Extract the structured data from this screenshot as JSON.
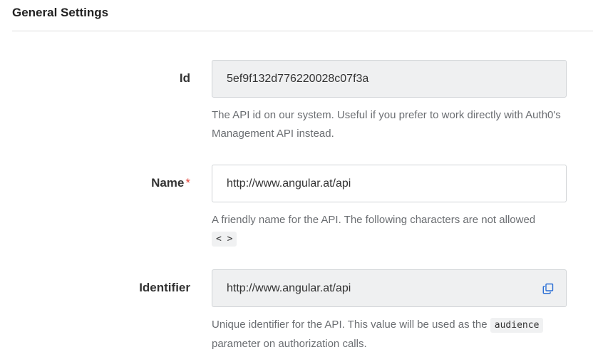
{
  "section": {
    "title": "General Settings"
  },
  "fields": {
    "id": {
      "label": "Id",
      "value": "5ef9f132d776220028c07f3a",
      "help": "The API id on our system. Useful if you prefer to work directly with Auth0's Management API instead."
    },
    "name": {
      "label": "Name",
      "required_mark": "*",
      "value": "http://www.angular.at/api",
      "help_text": "A friendly name for the API. The following characters are not allowed",
      "help_code": "< >"
    },
    "identifier": {
      "label": "Identifier",
      "value": "http://www.angular.at/api",
      "copy_icon": "copy-icon",
      "help_prefix": "Unique identifier for the API. This value will be used as the",
      "help_code": "audience",
      "help_suffix": "parameter on authorization calls."
    }
  },
  "colors": {
    "readonly_bg": "#eff0f1",
    "required": "#e2453c",
    "help_text": "#6b6e72",
    "copy_icon": "#2b6fd6"
  }
}
